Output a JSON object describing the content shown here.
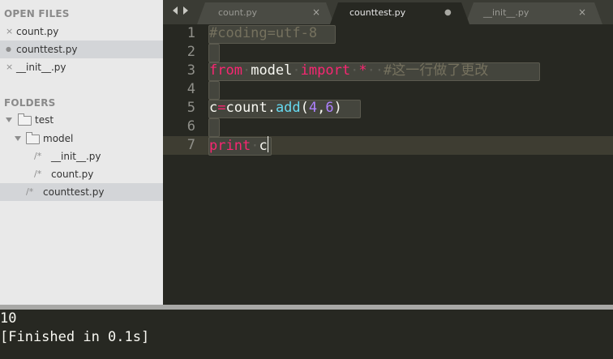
{
  "sidebar": {
    "open_files_title": "OPEN FILES",
    "open_files": [
      {
        "name": "count.py",
        "marker": "×"
      },
      {
        "name": "counttest.py",
        "marker": "●"
      },
      {
        "name": "__init__.py",
        "marker": "×"
      }
    ],
    "folders_title": "FOLDERS",
    "folders": {
      "root": "test",
      "model_folder": "model",
      "model_files": [
        "__init__.py",
        "count.py"
      ],
      "root_files": [
        "counttest.py"
      ],
      "file_glyph": "/*"
    }
  },
  "tabs": [
    {
      "label": "count.py",
      "control": "×"
    },
    {
      "label": "counttest.py",
      "control": "●"
    },
    {
      "label": "__init__.py",
      "control": "×"
    }
  ],
  "editor": {
    "line_numbers": [
      "1",
      "2",
      "3",
      "4",
      "5",
      "6",
      "7"
    ],
    "line1": {
      "comment": "#coding=utf-8"
    },
    "line3": {
      "kw_from": "from",
      "module": "model",
      "kw_import": "import",
      "star": "*",
      "comment": "#这一行做了更改"
    },
    "line5": {
      "var": "c",
      "eq": "=",
      "obj": "count",
      "dot": ".",
      "fn": "add",
      "lp": "(",
      "n1": "4",
      "comma": ",",
      "n2": "6",
      "rp": ")"
    },
    "line7": {
      "kw_print": "print",
      "var": "c"
    }
  },
  "output": {
    "lines": [
      "10",
      "[Finished in 0.1s]"
    ]
  },
  "colors": {
    "editor_bg": "#272822",
    "keyword": "#f92672",
    "function": "#66d9ef",
    "number": "#ae81ff",
    "comment": "#75715e",
    "text": "#f8f8f2"
  }
}
